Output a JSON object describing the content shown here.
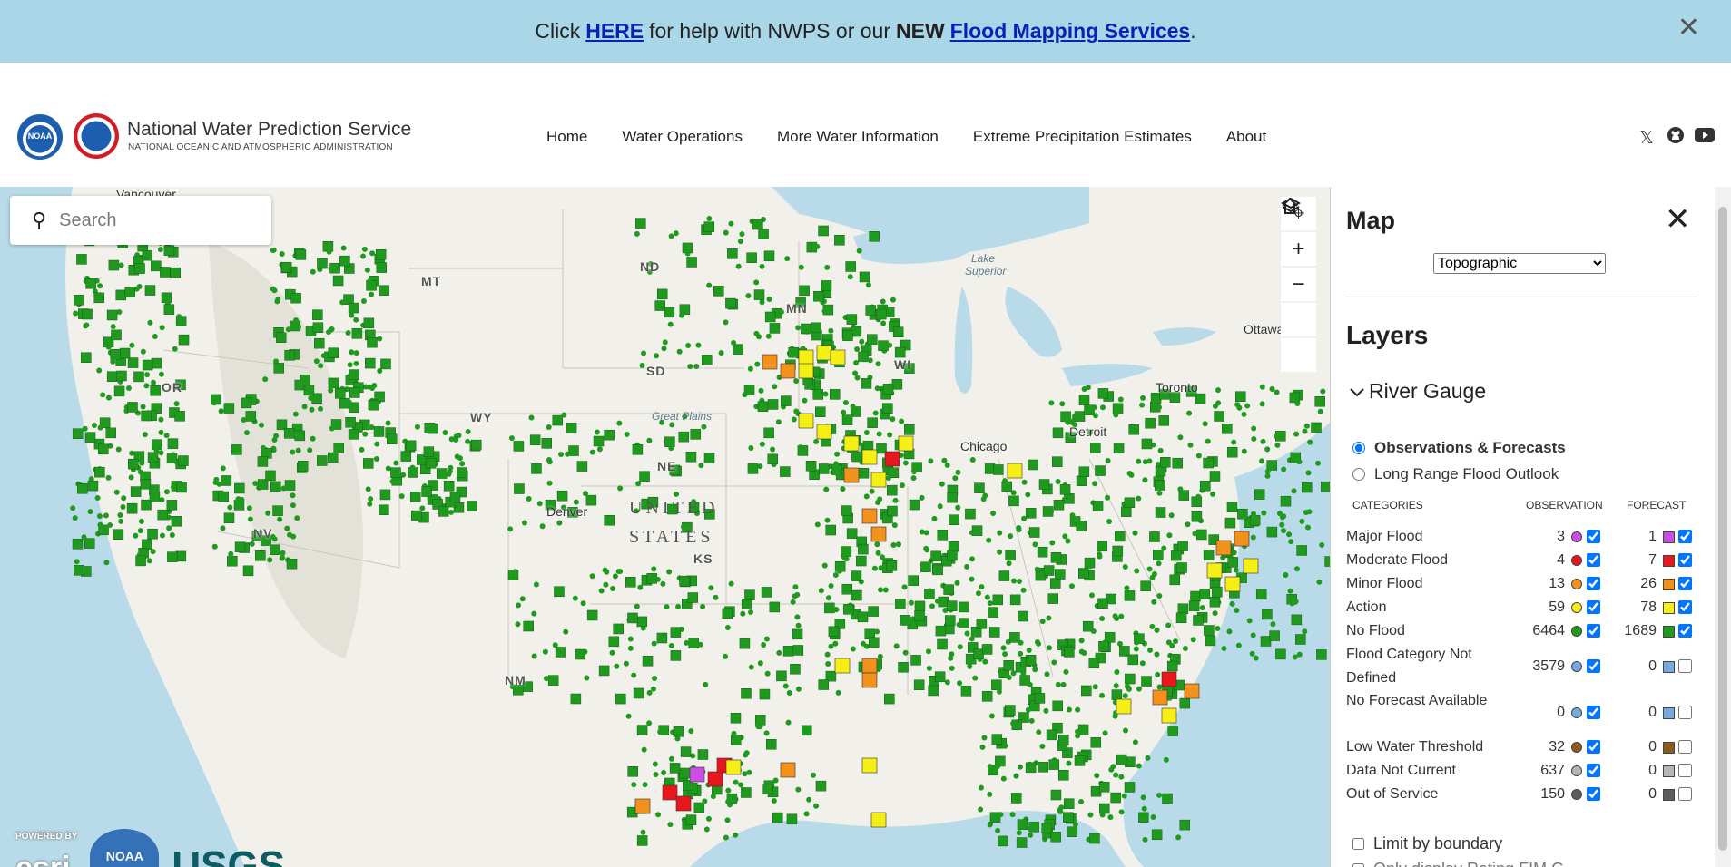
{
  "banner": {
    "prefix": "Click",
    "here_link": "HERE",
    "middle": "for help with NWPS or our",
    "new_word": "NEW",
    "flood_link": "Flood Mapping Services",
    "suffix": ".",
    "close": "✕"
  },
  "header": {
    "title": "National Water Prediction Service",
    "subtitle": "NATIONAL OCEANIC AND ATMOSPHERIC ADMINISTRATION",
    "noaa_logo_text": "NOAA",
    "nav": [
      "Home",
      "Water Operations",
      "More Water Information",
      "Extreme Precipitation Estimates",
      "About"
    ],
    "social_icons": [
      "x-icon",
      "github-icon",
      "youtube-icon"
    ]
  },
  "map": {
    "search_placeholder": "Search",
    "tools": [
      "locate-icon",
      "zoom-in-icon",
      "zoom-out-icon",
      "home-icon",
      "layers-icon"
    ],
    "state_labels": [
      "MT",
      "ND",
      "MN",
      "OR",
      "SD",
      "WY",
      "WI",
      "NE",
      "NV",
      "KS",
      "NM"
    ],
    "city_labels": [
      "Vancouver",
      "Denver",
      "Chicago",
      "Detroit",
      "Toronto",
      "Ottawa"
    ],
    "water_labels": [
      "Lake Superior",
      "Great Plains"
    ],
    "country_label_line1": "UNITED",
    "country_label_line2": "STATES",
    "attribution": {
      "esri_small": "POWERED BY",
      "esri": "esri",
      "noaa": "NOAA",
      "usgs": "USGS"
    }
  },
  "panel": {
    "title": "Map",
    "close": "✕",
    "basemap_selected": "Topographic",
    "layers_title": "Layers",
    "river_gauge_label": "River Gauge",
    "radio_observations": "Observations & Forecasts",
    "radio_long_range": "Long Range Flood Outlook",
    "col_categories": "CATEGORIES",
    "col_observation": "OBSERVATION",
    "col_forecast": "FORECAST",
    "categories": [
      {
        "name": "Major Flood",
        "obs": "3",
        "fc": "1",
        "color": "#c94fe3",
        "obs_checked": true,
        "fc_checked": true
      },
      {
        "name": "Moderate Flood",
        "obs": "4",
        "fc": "7",
        "color": "#e8161d",
        "obs_checked": true,
        "fc_checked": true
      },
      {
        "name": "Minor Flood",
        "obs": "13",
        "fc": "26",
        "color": "#f2911c",
        "obs_checked": true,
        "fc_checked": true
      },
      {
        "name": "Action",
        "obs": "59",
        "fc": "78",
        "color": "#f6ef15",
        "obs_checked": true,
        "fc_checked": true
      },
      {
        "name": "No Flood",
        "obs": "6464",
        "fc": "1689",
        "color": "#1f9a1f",
        "obs_checked": true,
        "fc_checked": true
      },
      {
        "name": "Flood Category Not Defined",
        "obs": "3579",
        "fc": "0",
        "color": "#76a9e0",
        "obs_checked": true,
        "fc_checked": false
      },
      {
        "name": "No Forecast Available",
        "obs": "0",
        "fc": "0",
        "color": "#76a9e0",
        "obs_checked": true,
        "fc_checked": false
      },
      {
        "name": "Low Water Threshold",
        "obs": "32",
        "fc": "0",
        "color": "#8b5a1c",
        "obs_checked": true,
        "fc_checked": false
      },
      {
        "name": "Data Not Current",
        "obs": "637",
        "fc": "0",
        "color": "#b6b6b6",
        "obs_checked": true,
        "fc_checked": false
      },
      {
        "name": "Out of Service",
        "obs": "150",
        "fc": "0",
        "color": "#5d5d5d",
        "obs_checked": true,
        "fc_checked": false
      }
    ],
    "limit_boundary": "Limit by boundary",
    "next_option": "Only display Rating FIM G..."
  }
}
